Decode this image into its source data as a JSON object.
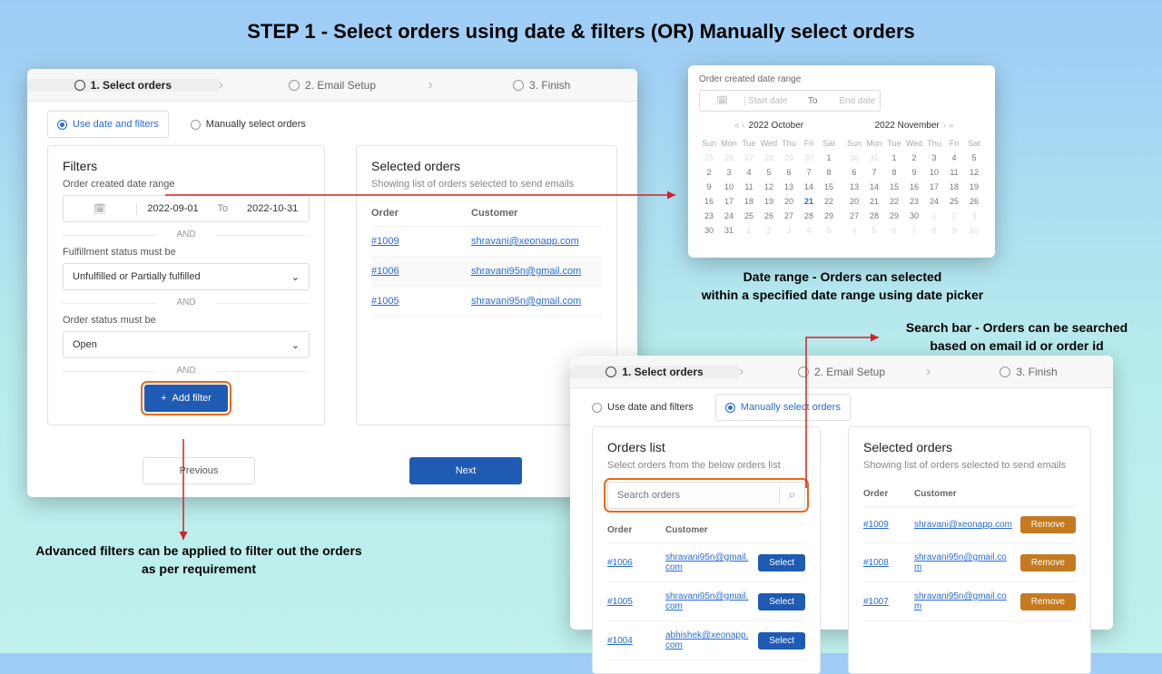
{
  "title": "STEP 1 - Select orders using date & filters (OR) Manually select orders",
  "steps": {
    "s1": "1. Select orders",
    "s2": "2. Email Setup",
    "s3": "3. Finish"
  },
  "radio": {
    "filters": "Use date and filters",
    "manual": "Manually select orders"
  },
  "filters": {
    "heading": "Filters",
    "dateLabel": "Order created date range",
    "dateFrom": "2022-09-01",
    "to": "To",
    "dateTo": "2022-10-31",
    "and": "AND",
    "fulfillLabel": "Fulfillment status must be",
    "fulfillValue": "Unfulfilled or Partially fulfilled",
    "statusLabel": "Order status must be",
    "statusValue": "Open",
    "addFilter": "Add filter"
  },
  "selected": {
    "heading": "Selected orders",
    "sub": "Showing list of orders selected to send emails",
    "colOrder": "Order",
    "colCust": "Customer",
    "rows": [
      {
        "o": "#1009",
        "c": "shravani@xeonapp.com"
      },
      {
        "o": "#1006",
        "c": "shravani95n@gmail.com"
      },
      {
        "o": "#1005",
        "c": "shravani95n@gmail.com"
      }
    ]
  },
  "nav": {
    "prev": "Previous",
    "next": "Next"
  },
  "dp": {
    "label": "Order created date range",
    "start": "Start date",
    "to": "To",
    "end": "End date",
    "m1": "2022 October",
    "m2": "2022 November"
  },
  "p3": {
    "olHeading": "Orders list",
    "olSub": "Select orders from the below orders list",
    "search": "Search orders",
    "colOrder": "Order",
    "colCust": "Customer",
    "rows": [
      {
        "o": "#1006",
        "c": "shravani95n@gmail.com",
        "b": "Select"
      },
      {
        "o": "#1005",
        "c": "shravani95n@gmail.com",
        "b": "Select"
      },
      {
        "o": "#1004",
        "c": "abhishek@xeonapp.com",
        "b": "Select"
      }
    ],
    "selHeading": "Selected orders",
    "selSub": "Showing list of orders selected to send emails",
    "selRows": [
      {
        "o": "#1009",
        "c": "shravani@xeonapp.com",
        "b": "Remove"
      },
      {
        "o": "#1008",
        "c": "shravani95n@gmail.com",
        "b": "Remove"
      },
      {
        "o": "#1007",
        "c": "shravani95n@gmail.com",
        "b": "Remove"
      }
    ]
  },
  "ann": {
    "filters1": "Advanced filters can be applied to filter out the orders",
    "filters2": "as per requirement",
    "date1": "Date range - Orders can selected",
    "date2": "within a specified date range using date picker",
    "search1": "Search bar - Orders can be searched",
    "search2": "based on email id or order id"
  }
}
